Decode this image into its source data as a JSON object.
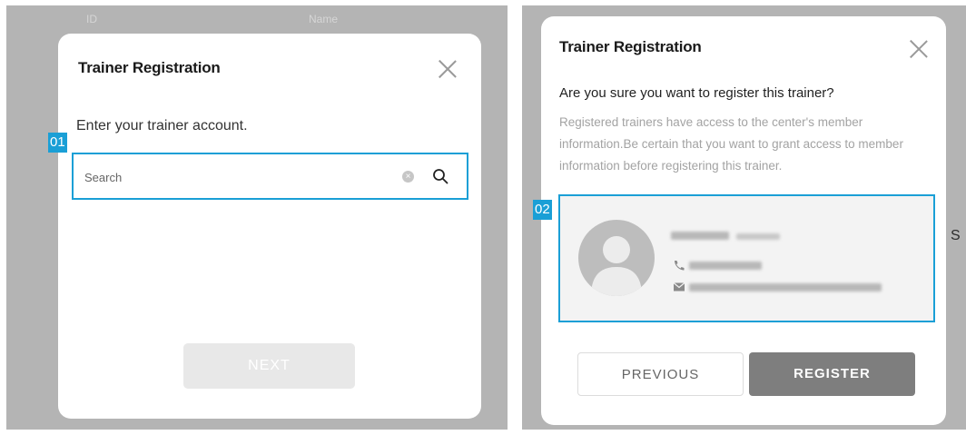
{
  "left_panel": {
    "background_table": {
      "col_id": "ID",
      "col_name": "Name"
    },
    "modal": {
      "title": "Trainer Registration",
      "instruction": "Enter your trainer account.",
      "step_badge": "01",
      "search": {
        "placeholder": "Search",
        "value": ""
      },
      "next_label": "NEXT"
    }
  },
  "right_panel": {
    "background_fragment": "S",
    "modal": {
      "title": "Trainer Registration",
      "question": "Are you sure you want to register this trainer?",
      "warning": "Registered trainers have access to the center's member information.Be certain that you want to grant access to member information before registering this trainer.",
      "step_badge": "02",
      "previous_label": "PREVIOUS",
      "register_label": "REGISTER"
    }
  },
  "colors": {
    "highlight": "#1a9fd6",
    "overlay": "#b4b4b4",
    "register_button": "#7e7e7e",
    "disabled_button": "#e8e8e8"
  },
  "icons": [
    "close-icon",
    "clear-icon",
    "search-icon",
    "avatar-icon",
    "phone-icon",
    "email-icon"
  ]
}
